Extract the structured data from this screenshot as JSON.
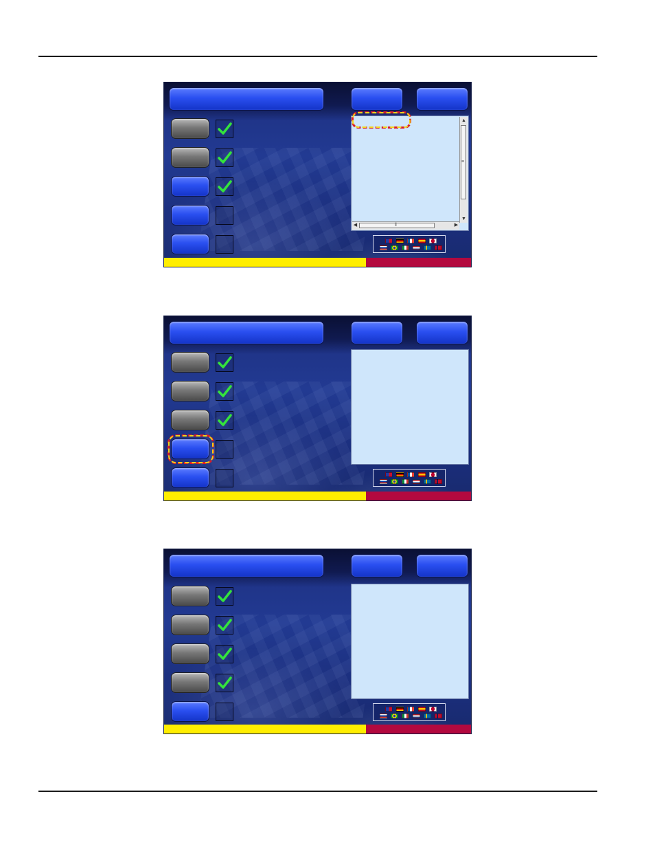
{
  "colors": {
    "button_blue": "#2a4ff0",
    "button_gray": "#777777",
    "panel_bg": "#cfe6fb",
    "footer_yellow": "#ffee00",
    "footer_red": "#b3093f",
    "checkmark_green": "#34e33c",
    "highlight_red": "#d81b2a",
    "highlight_yellow": "#f3d31a"
  },
  "icons": {
    "checkmark": "green-checkmark-icon",
    "flags": [
      "us-uk-flag-icon",
      "germany-flag-icon",
      "france-flag-icon",
      "spain-flag-icon",
      "japan-flag-icon",
      "russia-flag-icon",
      "brazil-flag-icon",
      "italy-flag-icon",
      "netherlands-flag-icon",
      "sweden-flag-icon",
      "norway-flag-icon"
    ]
  },
  "screens": [
    {
      "step_buttons": [
        "gray",
        "gray",
        "blue",
        "blue",
        "blue"
      ],
      "checked": [
        true,
        true,
        true,
        false,
        false
      ],
      "panel_scrollbars": true,
      "highlight": "panel-first-row"
    },
    {
      "step_buttons": [
        "gray",
        "gray",
        "gray",
        "blue",
        "blue"
      ],
      "checked": [
        true,
        true,
        true,
        false,
        false
      ],
      "panel_scrollbars": false,
      "highlight": "step-button-4"
    },
    {
      "step_buttons": [
        "gray",
        "gray",
        "gray",
        "gray",
        "blue"
      ],
      "checked": [
        true,
        true,
        true,
        true,
        false
      ],
      "panel_scrollbars": false,
      "highlight": "none"
    }
  ]
}
